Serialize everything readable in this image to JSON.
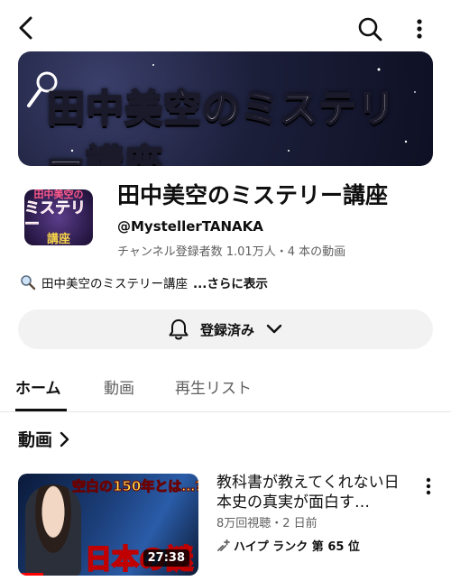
{
  "header": {
    "back_icon": "back-arrow-icon",
    "search_icon": "search-icon",
    "more_icon": "more-vertical-icon"
  },
  "banner": {
    "text": "田中美空のミステリー講座"
  },
  "channel": {
    "name": "田中美空のミステリー講座",
    "handle": "@MystellerTANAKA",
    "stats": "チャンネル登録者数 1.01万人・4 本の動画",
    "description": "田中美空のミステリー講座",
    "more_label": "...さらに表示",
    "avatar_text": [
      "田中美空の",
      "ミステリー",
      "講座"
    ]
  },
  "subscribe": {
    "label": "登録済み",
    "bell_icon": "bell-icon",
    "chevron_icon": "chevron-down-icon"
  },
  "tabs": [
    {
      "label": "ホーム",
      "active": true
    },
    {
      "label": "動画",
      "active": false
    },
    {
      "label": "再生リスト",
      "active": false
    }
  ],
  "section": {
    "title": "動画"
  },
  "video": {
    "title": "教科書が教えてくれない日本史の真実が面白す…",
    "meta": "8万回視聴・2 日前",
    "hype_label": "ハイプ ランク 第 65 位",
    "duration": "27:38",
    "thumb_top_text": "空白の150年とは…?",
    "thumb_big_text": "日本の謎",
    "watched_fraction": 0.14
  },
  "colors": {
    "progress": "#ff0000",
    "pill_bg": "#f2f2f2",
    "secondary_text": "#606060"
  }
}
